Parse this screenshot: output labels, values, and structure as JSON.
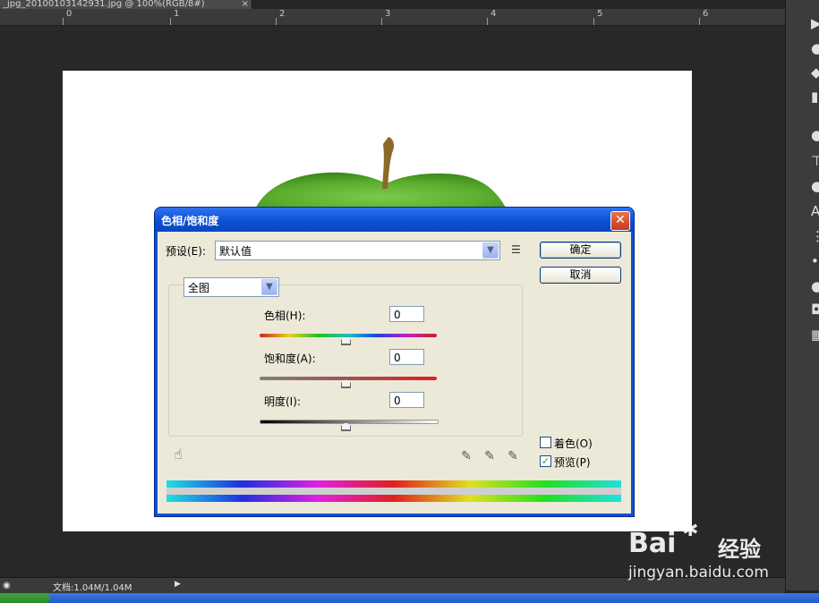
{
  "document": {
    "tab_title": "_jpg_20100103142931.jpg @ 100%(RGB/8#)",
    "tab_close": "×"
  },
  "ruler": {
    "labels": [
      "0",
      "1",
      "2",
      "3",
      "4",
      "5",
      "6"
    ]
  },
  "status": {
    "doc_info": "文档:1.04M/1.04M",
    "arrow": "▶"
  },
  "dialog": {
    "title": "色相/饱和度",
    "close_glyph": "✕",
    "preset_label": "预设(E):",
    "preset_value": "默认值",
    "preset_menu_icon": "preset-options-icon",
    "ok_label": "确定",
    "cancel_label": "取消",
    "channel_value": "全图",
    "hue_label": "色相(H):",
    "hue_value": "0",
    "saturation_label": "饱和度(A):",
    "saturation_value": "0",
    "lightness_label": "明度(I):",
    "lightness_value": "0",
    "colorize_label": "着色(O)",
    "colorize_checked": false,
    "preview_label": "预览(P)",
    "preview_checked": true,
    "check_glyph": "✓"
  },
  "watermark": {
    "brand": "Bai",
    "brand2": "经验",
    "url": "jingyan.baidu.com"
  },
  "colors": {
    "title_blue": "#0a52d4",
    "dialog_bg": "#ece9d8",
    "apple_green": "#5cae2e"
  }
}
